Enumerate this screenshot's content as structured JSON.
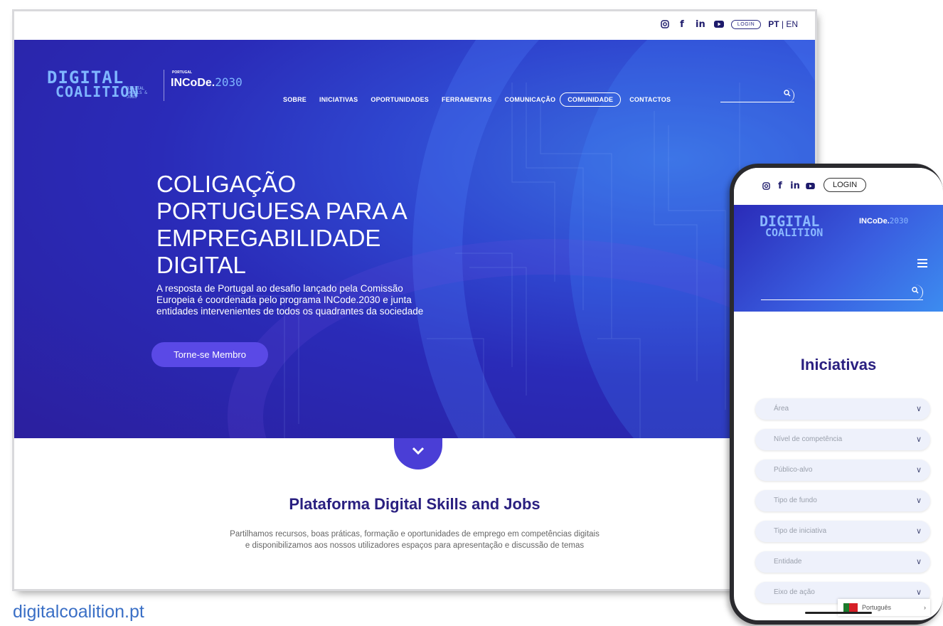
{
  "desktop": {
    "topbar": {
      "social_icons": [
        "instagram-icon",
        "facebook-icon",
        "linkedin-icon",
        "youtube-icon"
      ],
      "login_label": "LOGIN",
      "lang_pt": "PT",
      "lang_sep": " | ",
      "lang_en": "EN"
    },
    "logo": {
      "line1": "DIGITAL",
      "line2": "COALITION",
      "small": "DIGITAL SKILLS & JOBS"
    },
    "incode": {
      "country": "PORTUGAL",
      "name": "INCoDe.",
      "year": "2030"
    },
    "nav": [
      "SOBRE",
      "INICIATIVAS",
      "OPORTUNIDADES",
      "FERRAMENTAS",
      "COMUNICAÇÃO",
      "COMUNIDADE",
      "CONTACTOS"
    ],
    "hero": {
      "title": "COLIGAÇÃO PORTUGUESA PARA A EMPREGABILIDADE DIGITAL",
      "text": "A resposta de Portugal ao desafio lançado pela Comissão Europeia é coordenada pelo programa INCode.2030 e junta entidades intervenientes de todos os quadrantes da sociedade",
      "cta": "Torne-se Membro"
    },
    "section": {
      "title": "Plataforma Digital Skills and Jobs",
      "text_line1": "Partilhamos recursos, boas práticas, formação e oportunidades de emprego em competências digitais",
      "text_line2": "e disponibilizamos aos nossos utilizadores espaços para apresentação e discussão de temas"
    }
  },
  "caption": "digitalcoalition.pt",
  "phone": {
    "login_label": "LOGIN",
    "logo": {
      "line1": "DIGITAL",
      "line2": "COALITION"
    },
    "incode": {
      "name": "INCoDe.",
      "year": "2030"
    },
    "title": "Iniciativas",
    "filters": [
      "Área",
      "Nível de competência",
      "Público-alvo",
      "Tipo de fundo",
      "Tipo de iniciativa",
      "Entidade",
      "Eixo de ação"
    ],
    "language": "Português"
  },
  "colors": {
    "accent": "#2a2080",
    "hero_blue": "#2a2bb8",
    "cta": "#5a49e6",
    "link": "#3a6fc6"
  }
}
